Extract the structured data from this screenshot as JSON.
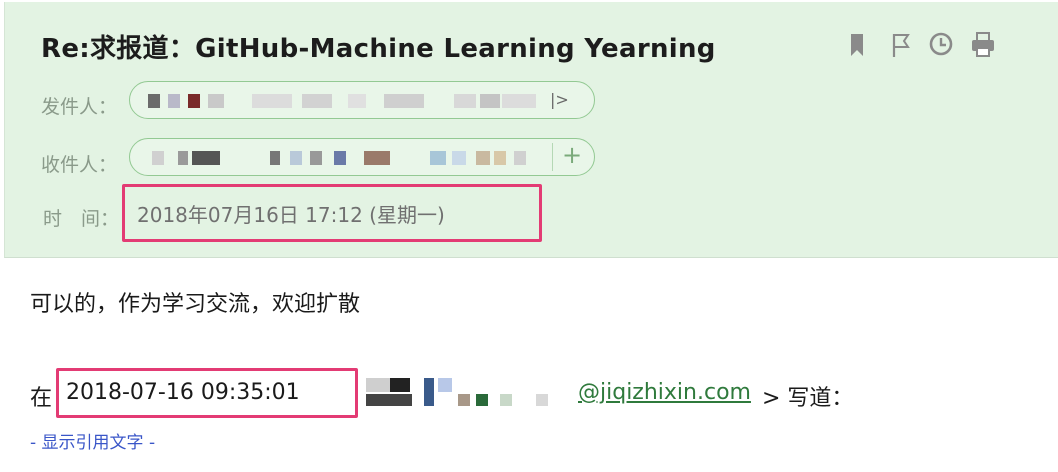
{
  "header": {
    "subject": "Re:求报道：GitHub-Machine Learning Yearning",
    "sender_label": "发件人：",
    "sender_trailing": "|>",
    "recipient_label": "收件人：",
    "recipient_add": "+",
    "time_label": "时　间：",
    "time_value": "2018年07月16日 17:12 (星期一)",
    "toolbar": [
      "bookmark-icon",
      "flag-icon",
      "clock-icon",
      "print-icon"
    ]
  },
  "body": {
    "message": "可以的，作为学习交流，欢迎扩散",
    "quote_prefix": "在",
    "quote_datetime": "2018-07-16 09:35:01",
    "quote_email": "@jiqizhixin.com",
    "quote_suffix": "> 写道：",
    "show_quote_link": "- 显示引用文字 -"
  },
  "colors": {
    "header_bg": "#e3f3e3",
    "highlight_box": "#e33b74",
    "link": "#3a56c8",
    "email_link": "#2f7a3c"
  }
}
